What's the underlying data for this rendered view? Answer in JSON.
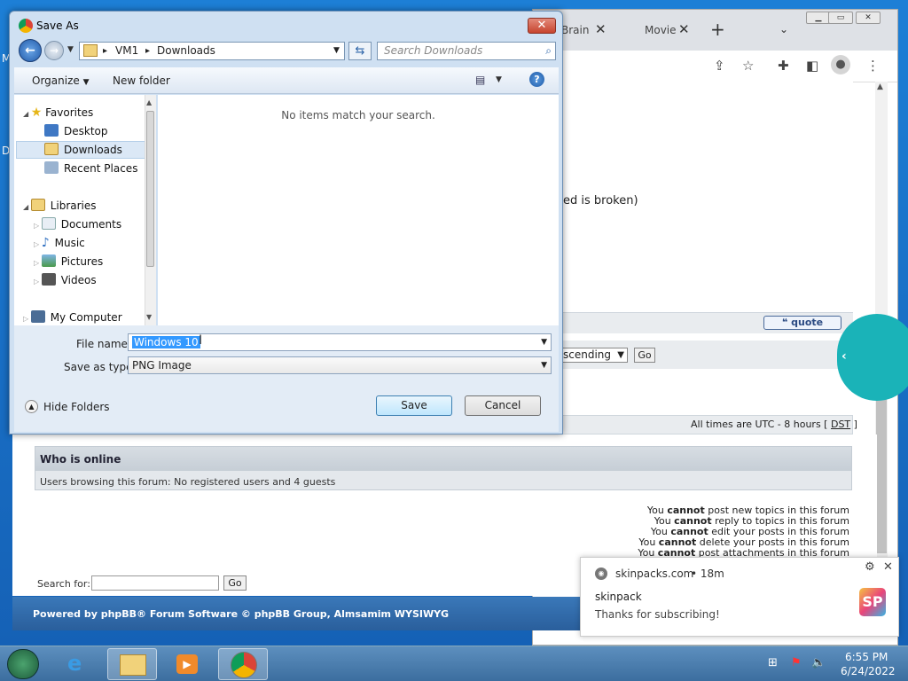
{
  "dialog": {
    "title": "Save As",
    "breadcrumb": [
      "VM1",
      "Downloads"
    ],
    "search_placeholder": "Search Downloads",
    "toolbar": {
      "organize": "Organize",
      "new_folder": "New folder"
    },
    "nav": {
      "favorites": "Favorites",
      "desktop": "Desktop",
      "downloads": "Downloads",
      "recent_places": "Recent Places",
      "libraries": "Libraries",
      "documents": "Documents",
      "music": "Music",
      "pictures": "Pictures",
      "videos": "Videos",
      "my_computer": "My Computer"
    },
    "empty_message": "No items match your search.",
    "file_name_label": "File name:",
    "file_name_value": "Windows 10",
    "save_as_type_label": "Save as type:",
    "save_as_type_value": "PNG Image",
    "hide_folders": "Hide Folders",
    "save_button": "Save",
    "cancel_button": "Cancel"
  },
  "browser": {
    "tab1": "Brain",
    "tab2": "Movie",
    "new_tab_symbol": "+"
  },
  "forum": {
    "post_fragment": "ed is broken)",
    "quote_button": "quote",
    "sort_value": "scending",
    "go": "Go",
    "times_text": "All times are UTC - 8 hours [",
    "dst": "DST",
    "times_close": "]",
    "who_is_online": "Who is online",
    "users_browsing": "Users browsing this forum: No registered users and 4 guests",
    "perm_word": "cannot",
    "permissions": [
      {
        "pre": "You",
        "rest": "post new topics in this forum"
      },
      {
        "pre": "You",
        "rest": "reply to topics in this forum"
      },
      {
        "pre": "You",
        "rest": "edit your posts in this forum"
      },
      {
        "pre": "You",
        "rest": "delete your posts in this forum"
      },
      {
        "pre": "You",
        "rest": "post attachments in this forum"
      }
    ],
    "search_for": "Search for:",
    "footer": "Powered by phpBB® Forum Software © phpBB Group, Almsamim WYSIWYG"
  },
  "notification": {
    "source": "skinpacks.com",
    "age": "• 18m",
    "title": "skinpack",
    "body": "Thanks for subscribing!",
    "logo": "SP"
  },
  "taskbar": {
    "time": "6:55 PM",
    "date": "6/24/2022"
  },
  "desktop_letters": [
    "M",
    "D"
  ]
}
